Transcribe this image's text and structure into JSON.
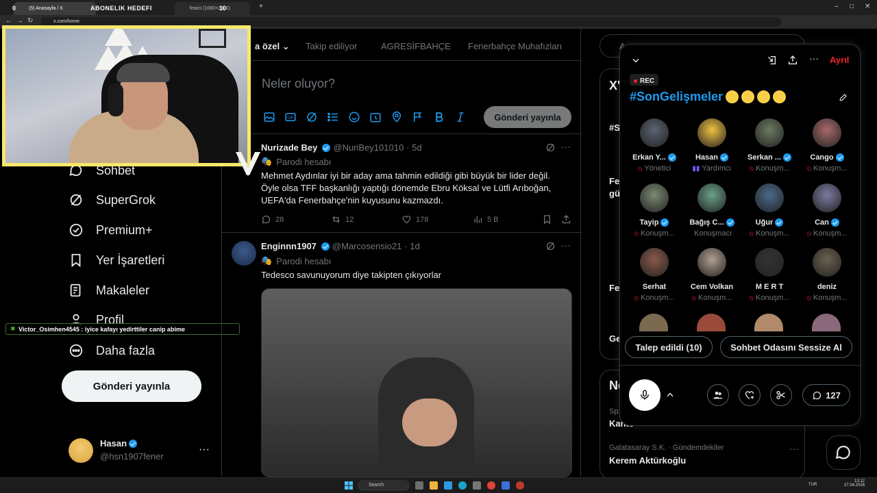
{
  "browser": {
    "tabs": [
      "(5) Anasayfa / X",
      "fearis (1080×1300)"
    ],
    "url": "x.com/home"
  },
  "overlay": {
    "sub_goal_title": "ABONELIK HEDEFI",
    "goal_left": "0",
    "goal_count": "10",
    "chat_user_msg": "Victor_Osimhen4545 : iyice kafayı yedirttiler canip abime"
  },
  "nav": {
    "items": [
      "Sohbet",
      "SuperGrok",
      "Premium+",
      "Yer İşaretleri",
      "Makaleler",
      "Profil",
      "Daha fazla"
    ],
    "post_button": "Gönderi yayınla",
    "account_name": "Hasan",
    "account_handle": "@hsn1907fener"
  },
  "timeline": {
    "tabs": [
      "a özel",
      "Takip ediliyor",
      "AGRESİFBAHÇE",
      "Fenerbahçe Muhafızları"
    ],
    "compose_placeholder": "Neler oluyor?",
    "compose_button": "Gönderi yayınla",
    "tweets": [
      {
        "name": "Nurizade Bey",
        "handle": "@NuriBey101010",
        "time": "· 5d",
        "label": "Parodi hesabı",
        "text": "Mehmet Aydınlar iyi bir aday ama tahmin edildiği gibi büyük bir lider değil. Öyle olsa TFF başkanlığı yaptığı dönemde Ebru Köksal ve Lütfi Arıboğan, UEFA'da Fenerbahçe'nin kuyusunu kazmazdı.",
        "replies": "28",
        "reposts": "12",
        "likes": "178",
        "views": "5 B"
      },
      {
        "name": "Enginnn1907",
        "handle": "@Marcosensio21",
        "time": "· 1d",
        "label": "Parodi hesabı",
        "text": "Tedesco savunuyorum diye takipten çıkıyorlar"
      }
    ]
  },
  "right_col": {
    "search_placeholder": "A",
    "frag1": "X'",
    "frag2": "#S",
    "frag3": "Fe",
    "frag4": "gü",
    "frag5": "Fe",
    "frag6": "Ge",
    "news_header": "Ne",
    "trend1_cat": "Sp",
    "trend1_title": "Kante",
    "trend2_cat": "Galatasaray S.K. · Gündemdekiler",
    "trend2_title": "Kerem Aktürkoğlu"
  },
  "space": {
    "rec": "REC",
    "title": "#SonGelişmeler",
    "leave": "Ayrıl",
    "users": [
      {
        "name": "Erkan Y...",
        "role": "Yönetici",
        "verified": true,
        "color": "#5b6470"
      },
      {
        "name": "Hasan",
        "role": "Yardımcı",
        "verified": true,
        "color": "#f0c040"
      },
      {
        "name": "Serkan ...",
        "role": "Konuşm...",
        "verified": true,
        "color": "#6c7a60"
      },
      {
        "name": "Cango",
        "role": "Konuşm...",
        "verified": true,
        "color": "#a86a6a"
      },
      {
        "name": "Tayip",
        "role": "Konuşm...",
        "verified": true,
        "color": "#7a8a70"
      },
      {
        "name": "Bağış C...",
        "role": "Konuşmacı",
        "verified": true,
        "color": "#6aa08a"
      },
      {
        "name": "Uğur",
        "role": "Konuşm...",
        "verified": true,
        "color": "#4a6a8a"
      },
      {
        "name": "Can",
        "role": "Konuşm...",
        "verified": true,
        "color": "#7a7aa0"
      },
      {
        "name": "Serhat",
        "role": "Konuşm...",
        "verified": false,
        "color": "#8a5a4a"
      },
      {
        "name": "Cem Volkan",
        "role": "Konuşm...",
        "verified": false,
        "color": "#b0a090"
      },
      {
        "name": "M E R T",
        "role": "Konuşm...",
        "verified": false,
        "color": "#333"
      },
      {
        "name": "deniz",
        "role": "Konuşm...",
        "verified": false,
        "color": "#6a6050"
      }
    ],
    "request_btn": "Talep edildi (10)",
    "mute_btn": "Sohbet Odasını Sessize Al",
    "comments": "127"
  },
  "taskbar": {
    "search": "Search",
    "lang": "TUR",
    "time": "13:12",
    "date": "27.04.2026"
  }
}
